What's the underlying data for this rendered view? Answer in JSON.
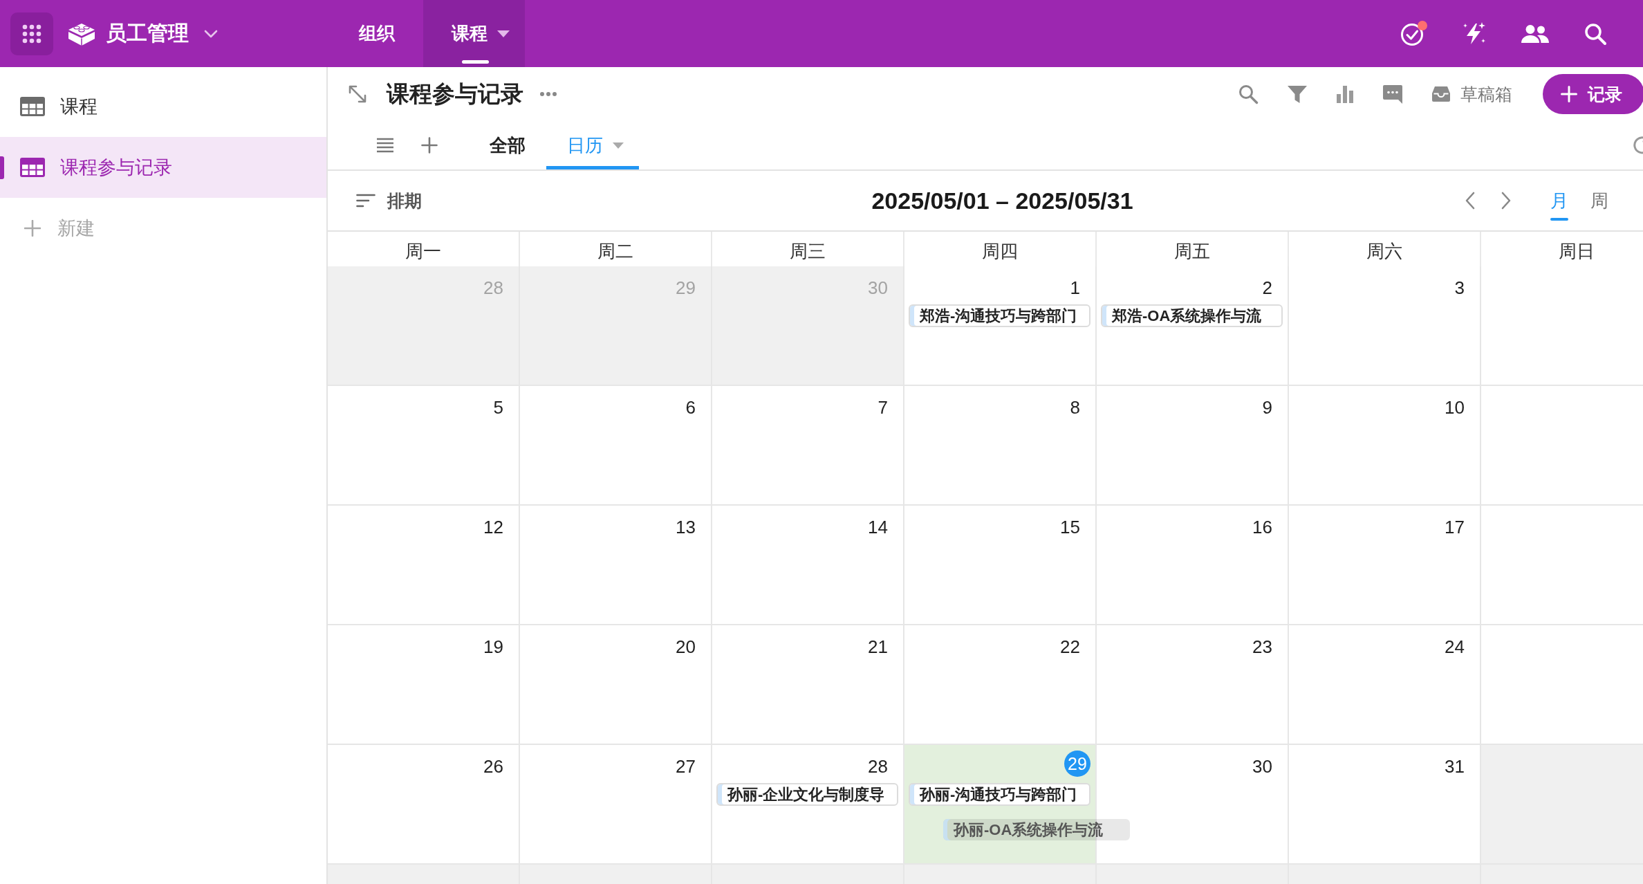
{
  "app_bar": {
    "title": "员工管理",
    "nav": [
      {
        "label": "组织",
        "selected": false
      },
      {
        "label": "课程",
        "selected": true
      }
    ],
    "task_alert": true
  },
  "sidebar": {
    "items": [
      {
        "label": "课程",
        "selected": false
      },
      {
        "label": "课程参与记录",
        "selected": true
      }
    ],
    "new_item": "新建"
  },
  "view": {
    "title": "课程参与记录",
    "drafts": "草稿箱",
    "add_record": "记录",
    "tabs": [
      {
        "label": "全部",
        "selected": false
      },
      {
        "label": "日历",
        "selected": true
      }
    ]
  },
  "calendar": {
    "schedule": "排期",
    "range": "2025/05/01 – 2025/05/31",
    "modes": [
      {
        "label": "月",
        "selected": true
      },
      {
        "label": "周",
        "selected": false
      }
    ],
    "weekdays": [
      "周一",
      "周二",
      "周三",
      "周四",
      "周五",
      "周六",
      "周日"
    ],
    "weeks": [
      [
        {
          "day": "28",
          "outside": true,
          "today": false,
          "drop_target": false
        },
        {
          "day": "29",
          "outside": true,
          "today": false,
          "drop_target": false
        },
        {
          "day": "30",
          "outside": true,
          "today": false,
          "drop_target": false
        },
        {
          "day": "1",
          "outside": false,
          "today": false,
          "drop_target": false,
          "events": [
            {
              "title": "郑浩-沟通技巧与跨部门"
            }
          ]
        },
        {
          "day": "2",
          "outside": false,
          "today": false,
          "drop_target": false,
          "events": [
            {
              "title": "郑浩-OA系统操作与流"
            }
          ]
        },
        {
          "day": "3",
          "outside": false,
          "today": false,
          "drop_target": false
        },
        {
          "outside": false,
          "drop_target": false
        }
      ],
      [
        {
          "day": "5",
          "outside": false,
          "today": false,
          "drop_target": false
        },
        {
          "day": "6",
          "outside": false,
          "today": false,
          "drop_target": false
        },
        {
          "day": "7",
          "outside": false,
          "today": false,
          "drop_target": false
        },
        {
          "day": "8",
          "outside": false,
          "today": false,
          "drop_target": false
        },
        {
          "day": "9",
          "outside": false,
          "today": false,
          "drop_target": false
        },
        {
          "day": "10",
          "outside": false,
          "today": false,
          "drop_target": false
        },
        {
          "outside": false,
          "drop_target": false
        }
      ],
      [
        {
          "day": "12",
          "outside": false,
          "today": false,
          "drop_target": false
        },
        {
          "day": "13",
          "outside": false,
          "today": false,
          "drop_target": false
        },
        {
          "day": "14",
          "outside": false,
          "today": false,
          "drop_target": false
        },
        {
          "day": "15",
          "outside": false,
          "today": false,
          "drop_target": false
        },
        {
          "day": "16",
          "outside": false,
          "today": false,
          "drop_target": false
        },
        {
          "day": "17",
          "outside": false,
          "today": false,
          "drop_target": false
        },
        {
          "outside": false,
          "drop_target": false
        }
      ],
      [
        {
          "day": "19",
          "outside": false,
          "today": false,
          "drop_target": false
        },
        {
          "day": "20",
          "outside": false,
          "today": false,
          "drop_target": false
        },
        {
          "day": "21",
          "outside": false,
          "today": false,
          "drop_target": false
        },
        {
          "day": "22",
          "outside": false,
          "today": false,
          "drop_target": false
        },
        {
          "day": "23",
          "outside": false,
          "today": false,
          "drop_target": false
        },
        {
          "day": "24",
          "outside": false,
          "today": false,
          "drop_target": false
        },
        {
          "outside": false,
          "drop_target": false
        }
      ],
      [
        {
          "day": "26",
          "outside": false,
          "today": false,
          "drop_target": false
        },
        {
          "day": "27",
          "outside": false,
          "today": false,
          "drop_target": false
        },
        {
          "day": "28",
          "outside": false,
          "today": false,
          "drop_target": false,
          "events": [
            {
              "title": "孙丽-企业文化与制度导"
            }
          ]
        },
        {
          "day": "29",
          "outside": false,
          "today": true,
          "drop_target": true,
          "events": [
            {
              "title": "孙丽-沟通技巧与跨部门"
            }
          ],
          "drag_preview": {
            "title": "孙丽-OA系统操作与流"
          }
        },
        {
          "day": "30",
          "outside": false,
          "today": false,
          "drop_target": false
        },
        {
          "day": "31",
          "outside": false,
          "today": false,
          "drop_target": false
        },
        {
          "outside": true,
          "drop_target": false
        }
      ],
      [
        {
          "outside": true,
          "drop_target": false
        },
        {
          "outside": true,
          "drop_target": false
        },
        {
          "outside": true,
          "drop_target": false
        },
        {
          "outside": true,
          "drop_target": false
        },
        {
          "outside": true,
          "drop_target": false
        },
        {
          "outside": true,
          "drop_target": false
        },
        {
          "outside": true,
          "drop_target": false
        }
      ]
    ]
  }
}
